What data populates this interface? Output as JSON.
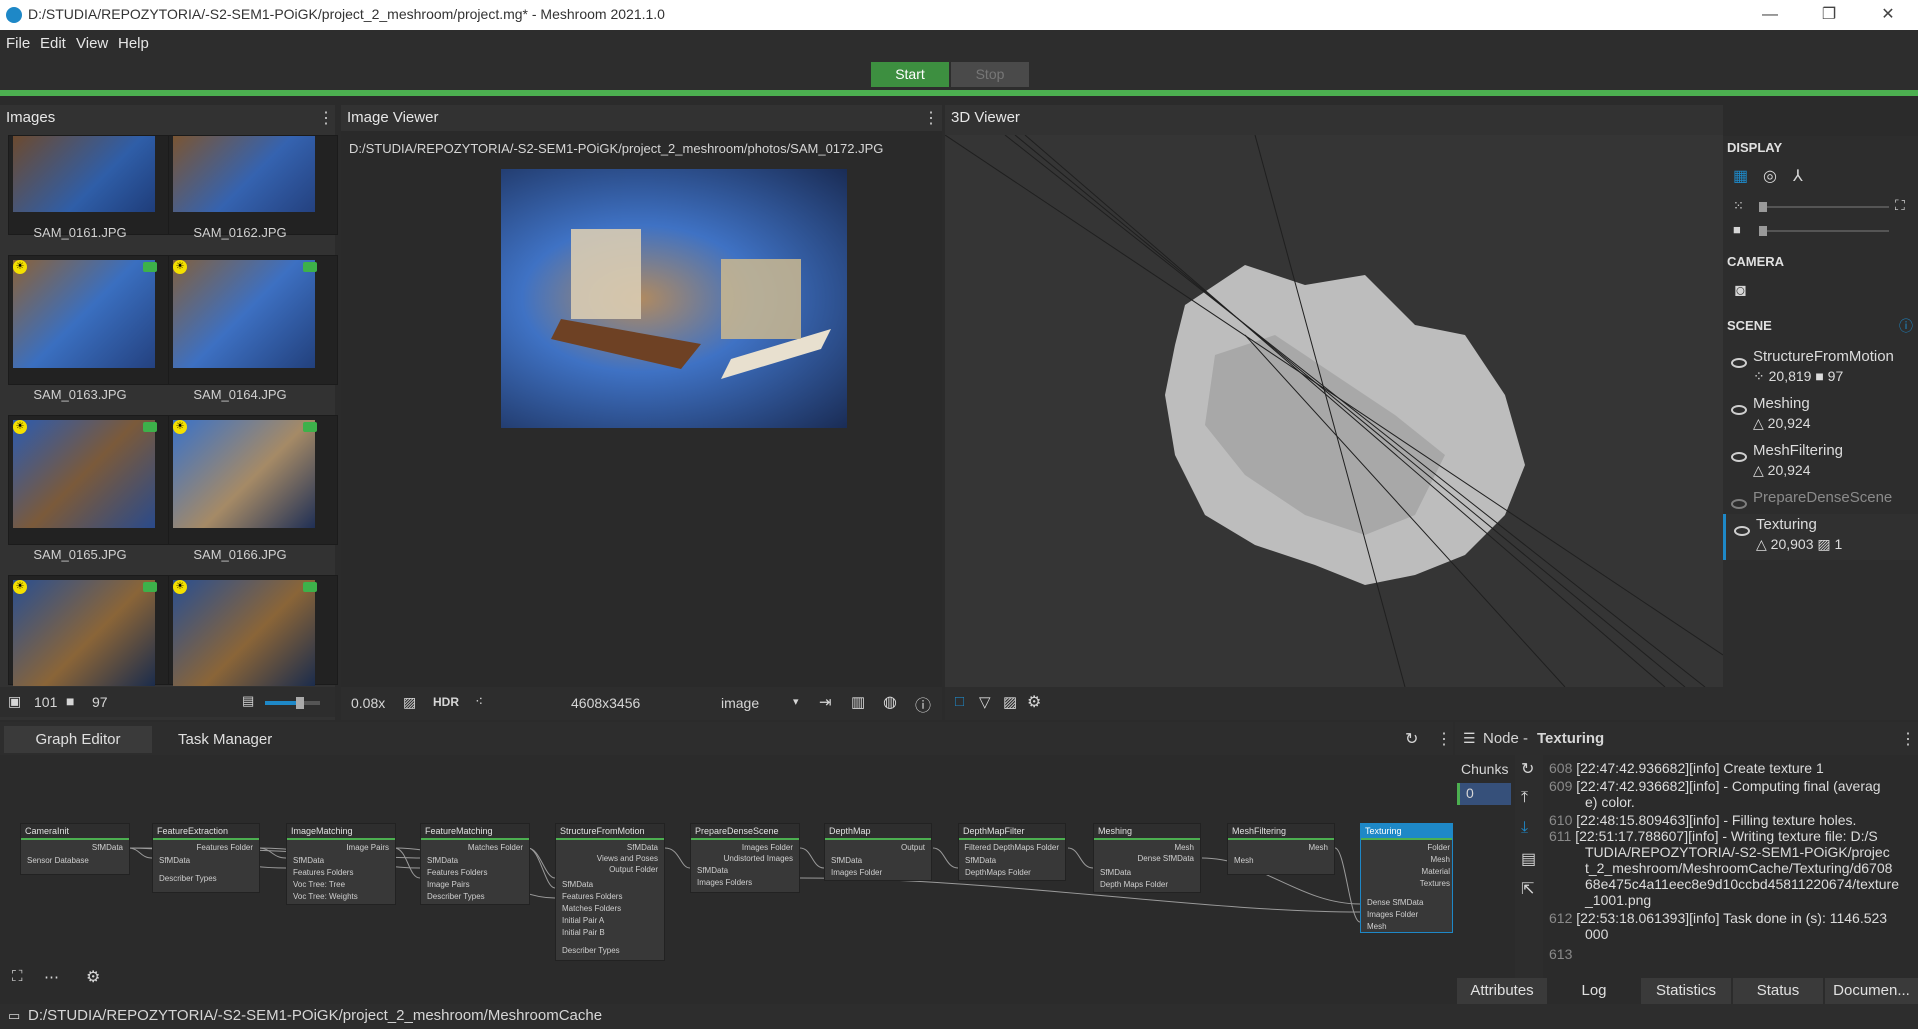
{
  "window": {
    "title": "D:/STUDIA/REPOZYTORIA/-S2-SEM1-POiGK/project_2_meshroom/project.mg* - Meshroom 2021.1.0",
    "minimize": "—",
    "maximize": "❐",
    "close": "✕"
  },
  "menu": {
    "file": "File",
    "edit": "Edit",
    "view": "View",
    "help": "Help"
  },
  "toolbar": {
    "start": "Start",
    "stop": "Stop"
  },
  "images": {
    "title": "Images",
    "thumbs": [
      {
        "label": "SAM_0161.JPG"
      },
      {
        "label": "SAM_0162.JPG"
      },
      {
        "label": "SAM_0163.JPG"
      },
      {
        "label": "SAM_0164.JPG"
      },
      {
        "label": "SAM_0165.JPG"
      },
      {
        "label": "SAM_0166.JPG"
      }
    ],
    "image_count": "101",
    "camera_count": "97"
  },
  "image_viewer": {
    "title": "Image Viewer",
    "path": "D:/STUDIA/REPOZYTORIA/-S2-SEM1-POiGK/project_2_meshroom/photos/SAM_0172.JPG",
    "zoom": "0.08x",
    "hdr": "HDR",
    "resolution": "4608x3456",
    "mode": "image"
  },
  "viewer3d": {
    "title": "3D Viewer"
  },
  "display": {
    "display_title": "DISPLAY",
    "camera_title": "CAMERA",
    "scene_title": "SCENE",
    "scene_items": [
      {
        "name": "StructureFromMotion",
        "meta": "⁘ 20,819  ■ 97"
      },
      {
        "name": "Meshing",
        "meta": "△ 20,924"
      },
      {
        "name": "MeshFiltering",
        "meta": "△ 20,924"
      },
      {
        "name": "PrepareDenseScene",
        "meta": ""
      },
      {
        "name": "Texturing",
        "meta": "△ 20,903  ▨ 1"
      }
    ]
  },
  "graph": {
    "tabs": [
      "Graph Editor",
      "Task Manager"
    ],
    "nodes": [
      {
        "name": "CameraInit",
        "inputs": [
          "Sensor Database"
        ],
        "outputs": [
          "SfMData"
        ]
      },
      {
        "name": "FeatureExtraction",
        "inputs": [
          "SfMData",
          "Describer Types"
        ],
        "outputs": [
          "Features Folder"
        ]
      },
      {
        "name": "ImageMatching",
        "inputs": [
          "SfMData",
          "Features Folders",
          "Voc Tree: Tree",
          "Voc Tree: Weights"
        ],
        "outputs": [
          "Image Pairs"
        ]
      },
      {
        "name": "FeatureMatching",
        "inputs": [
          "SfMData",
          "Features Folders",
          "Image Pairs",
          "Describer Types"
        ],
        "outputs": [
          "Matches Folder"
        ]
      },
      {
        "name": "StructureFromMotion",
        "inputs": [
          "SfMData",
          "Features Folders",
          "Matches Folders",
          "Initial Pair A",
          "Initial Pair B",
          "Describer Types"
        ],
        "outputs": [
          "SfMData",
          "Views and Poses",
          "Output Folder"
        ]
      },
      {
        "name": "PrepareDenseScene",
        "inputs": [
          "SfMData",
          "Images Folders"
        ],
        "outputs": [
          "Images Folder",
          "Undistorted Images"
        ]
      },
      {
        "name": "DepthMap",
        "inputs": [
          "SfMData",
          "Images Folder"
        ],
        "outputs": [
          "Output"
        ]
      },
      {
        "name": "DepthMapFilter",
        "inputs": [
          "SfMData",
          "DepthMaps Folder"
        ],
        "outputs": [
          "Filtered DepthMaps Folder"
        ]
      },
      {
        "name": "Meshing",
        "inputs": [
          "SfMData",
          "Depth Maps Folder"
        ],
        "outputs": [
          "Mesh",
          "Dense SfMData"
        ]
      },
      {
        "name": "MeshFiltering",
        "inputs": [
          "Mesh"
        ],
        "outputs": [
          "Mesh"
        ]
      },
      {
        "name": "Texturing",
        "inputs": [
          "Dense SfMData",
          "Images Folder",
          "Mesh"
        ],
        "outputs": [
          "Folder",
          "Mesh",
          "Material",
          "Textures"
        ]
      }
    ]
  },
  "node_panel": {
    "prefix": "Node - ",
    "node_name": "Texturing",
    "chunks_label": "Chunks",
    "chunk_value": "0",
    "log": [
      {
        "num": "608",
        "text": "[22:47:42.936682][info] Create texture 1"
      },
      {
        "num": "609",
        "text": "[22:47:42.936682][info]   - Computing final (averag"
      },
      {
        "num": "",
        "text": "e) color."
      },
      {
        "num": "610",
        "text": "[22:48:15.809463][info]   - Filling texture holes."
      },
      {
        "num": "611",
        "text": "[22:51:17.788607][info]   - Writing texture file: D:/S"
      },
      {
        "num": "",
        "text": "TUDIA/REPOZYTORIA/-S2-SEM1-POiGK/projec"
      },
      {
        "num": "",
        "text": "t_2_meshroom/MeshroomCache/Texturing/d6708"
      },
      {
        "num": "",
        "text": "68e475c4a11eec8e9d10ccbd45811220674/texture"
      },
      {
        "num": "",
        "text": "_1001.png"
      },
      {
        "num": "612",
        "text": "[22:53:18.061393][info] Task done in (s): 1146.523"
      },
      {
        "num": "",
        "text": "000"
      },
      {
        "num": "613",
        "text": ""
      }
    ],
    "tabs": [
      "Attributes",
      "Log",
      "Statistics",
      "Status",
      "Documen..."
    ]
  },
  "statusbar": {
    "path": "D:/STUDIA/REPOZYTORIA/-S2-SEM1-POiGK/project_2_meshroom/MeshroomCache"
  },
  "colors": {
    "accent_green": "#4caf50",
    "selected_blue": "#1e88c7"
  }
}
